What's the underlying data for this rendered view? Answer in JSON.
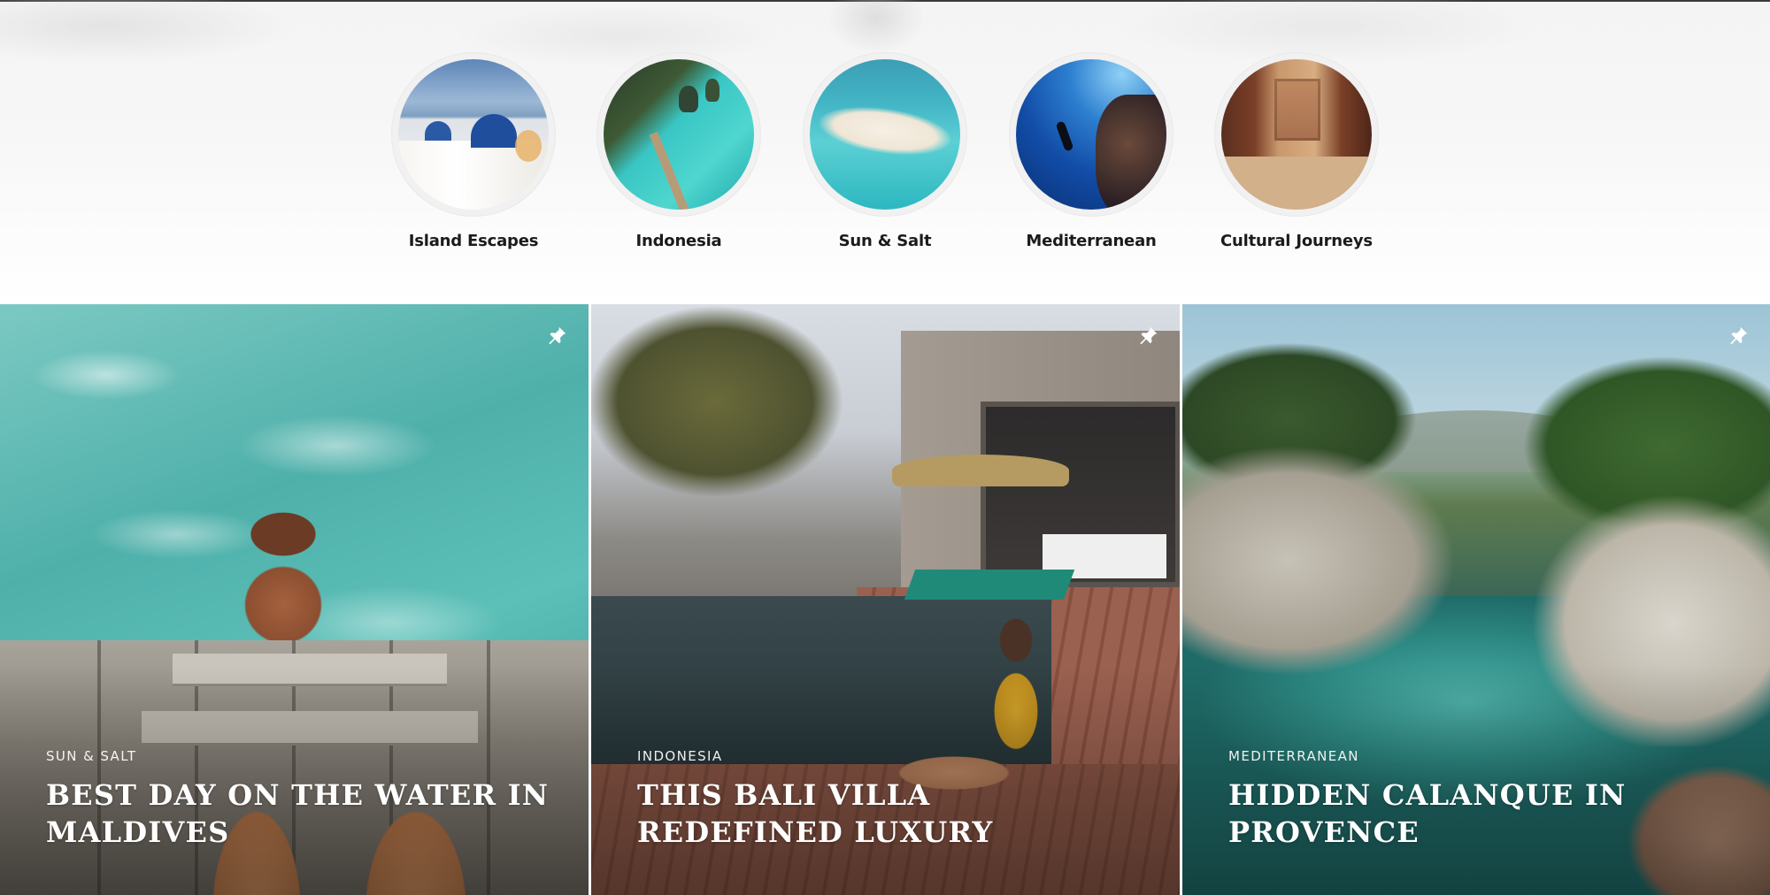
{
  "categories": [
    {
      "label": "Island Escapes",
      "image": "santorini-domes"
    },
    {
      "label": "Indonesia",
      "image": "lagoon-boardwalk"
    },
    {
      "label": "Sun & Salt",
      "image": "sandbar-turquoise"
    },
    {
      "label": "Mediterranean",
      "image": "underwater-diver"
    },
    {
      "label": "Cultural Journeys",
      "image": "petra-treasury"
    }
  ],
  "cards": [
    {
      "category": "Sun & Salt",
      "title": "Best day on the water in Maldives",
      "icon": "pin-icon"
    },
    {
      "category": "Indonesia",
      "title": "This Bali villa redefined luxury",
      "icon": "pin-icon"
    },
    {
      "category": "Mediterranean",
      "title": "Hidden calanque in Provence",
      "icon": "pin-icon"
    }
  ],
  "colors": {
    "label_text": "#1b1b1b",
    "overlay_text": "#ffffff",
    "ring": "#f1f1f1"
  }
}
